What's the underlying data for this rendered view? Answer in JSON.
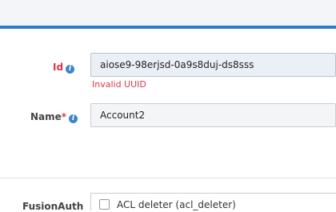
{
  "form": {
    "id_field": {
      "label": "Id",
      "value": "aiose9-98erjsd-0a9s8duj-ds8sss",
      "error": "Invalid UUID"
    },
    "name_field": {
      "label": "Name",
      "required_mark": "*",
      "value": "Account2"
    },
    "section": {
      "label": "FusionAuth",
      "checkbox_label": "ACL deleter (acl_deleter)",
      "checked": false
    },
    "info_glyph": "i"
  },
  "colors": {
    "accent": "#2f7fc4",
    "error": "#d9364a",
    "info": "#3a86c8"
  }
}
